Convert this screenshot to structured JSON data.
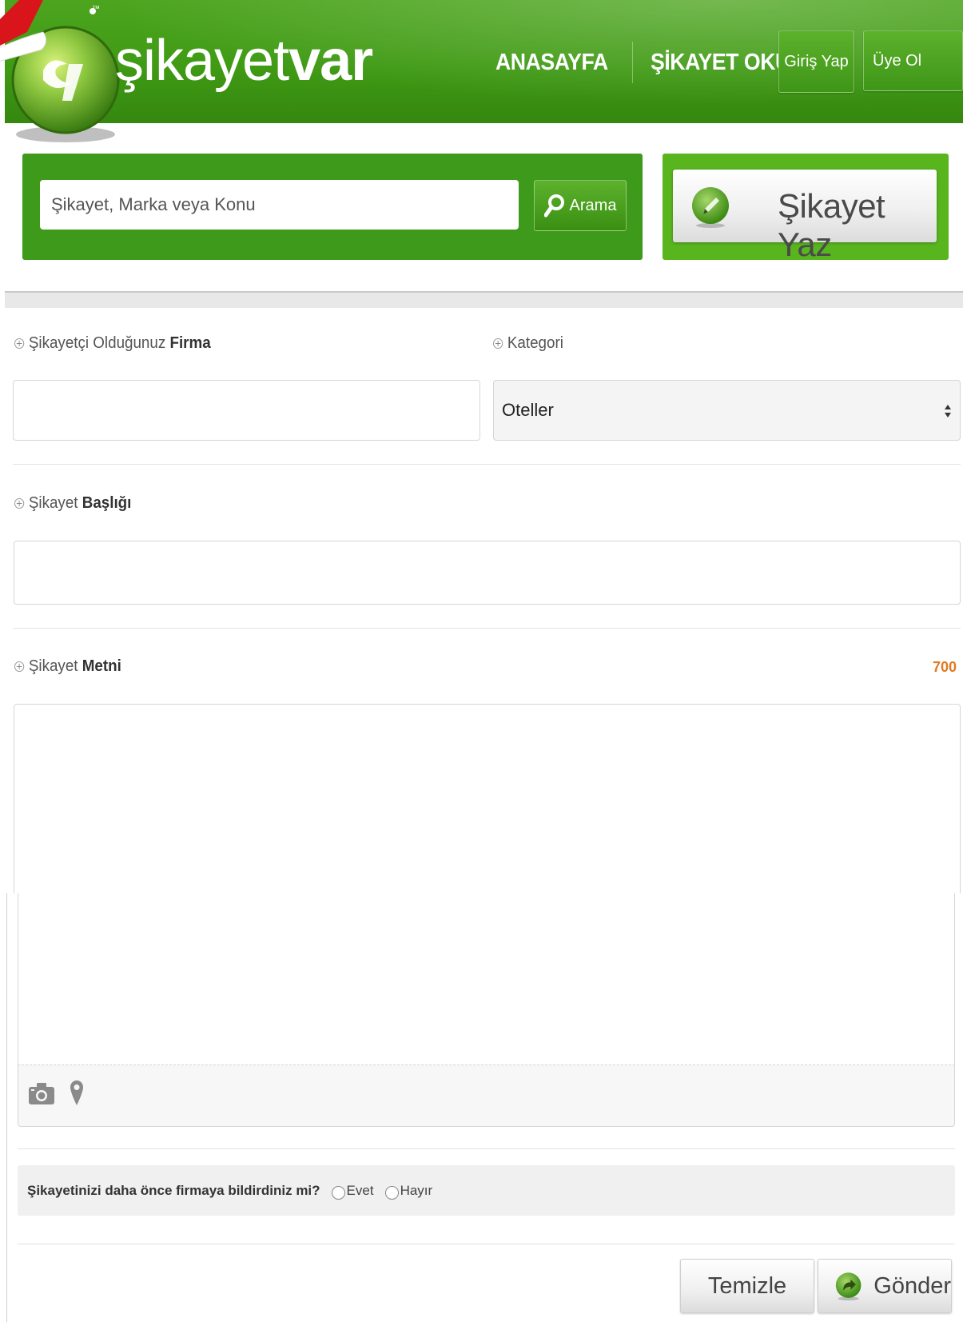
{
  "header": {
    "logo_light": "şikayet",
    "logo_bold": "var",
    "logo_tm": "™",
    "nav": [
      {
        "label": "ANASAYFA"
      },
      {
        "label": "ŞİKAYET OKU"
      }
    ],
    "login_label": "Giriş Yap",
    "register_label": "Üye Ol"
  },
  "search": {
    "placeholder": "Şikayet, Marka veya Konu",
    "button_label": "Arama"
  },
  "write_button_label": "Şikayet Yaz",
  "form": {
    "company_label_pre": "Şikayetçi Olduğunuz",
    "company_label_bold": "Firma",
    "company_value": "",
    "category_label": "Kategori",
    "category_selected": "Oteller",
    "title_label_pre": "Şikayet",
    "title_label_bold": "Başlığı",
    "title_value": "",
    "text_label_pre": "Şikayet",
    "text_label_bold": "Metni",
    "char_counter": "700",
    "text_value": ""
  },
  "question": {
    "text": "Şikayetinizi daha önce firmaya bildirdiniz mi?",
    "option_yes": "Evet",
    "option_no": "Hayır"
  },
  "buttons": {
    "clear_label": "Temizle",
    "send_label": "Gönder"
  },
  "colors": {
    "brand_green": "#3f9a14",
    "accent_orange": "#e07a1f"
  }
}
